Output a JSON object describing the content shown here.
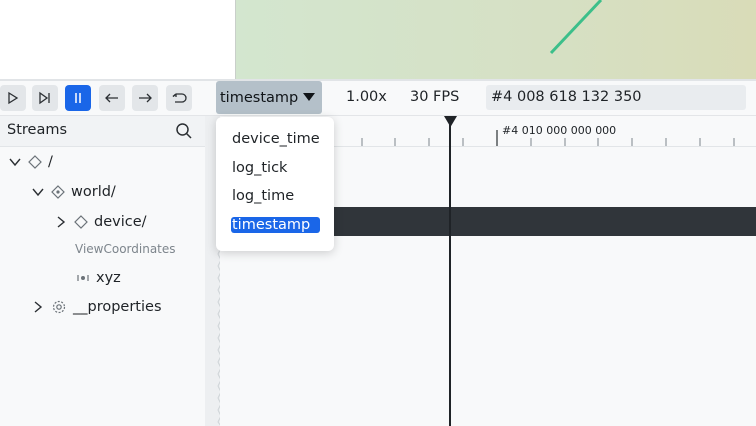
{
  "toolbar": {
    "timeline_selector": "timestamp",
    "playback_speed": "1.00x",
    "fps": "30 FPS",
    "current_time": "#4 008 618 132 350"
  },
  "timeline_menu": {
    "items": [
      "device_time",
      "log_tick",
      "log_time",
      "timestamp"
    ],
    "selected": "timestamp"
  },
  "streams": {
    "title": "Streams",
    "tree": {
      "root": "/",
      "world": "world/",
      "device": "device/",
      "device_component": "ViewCoordinates",
      "xyz": "xyz",
      "properties": "__properties"
    }
  },
  "timeline": {
    "ruler_label": "#4 010 000 000 000"
  },
  "colors": {
    "accent": "#1a66e8",
    "track": "#30353a",
    "selector_bg": "#b4c0c9",
    "viewport_line": "#3cbf8a"
  }
}
